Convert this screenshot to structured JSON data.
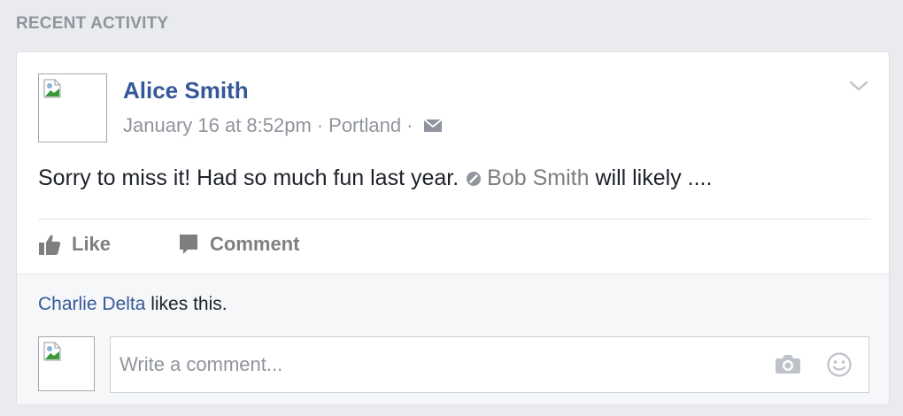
{
  "section": {
    "title": "RECENT ACTIVITY"
  },
  "post": {
    "author": "Alice Smith",
    "timestamp": "January 16 at 8:52pm",
    "separator": "·",
    "location": "Portland",
    "text_before": "Sorry to miss it! Had so much fun last year.",
    "mention": "Bob Smith",
    "text_after": " will likely ....",
    "options_icon": "chevron-down-icon",
    "audience_icon": "envelope-icon",
    "tag_icon": "tag-icon"
  },
  "actions": {
    "like_label": "Like",
    "comment_label": "Comment",
    "like_icon": "thumbs-up-icon",
    "comment_icon": "speech-bubble-icon"
  },
  "likes": {
    "liker": "Charlie Delta",
    "suffix": " likes this."
  },
  "comment_box": {
    "placeholder": "Write a comment...",
    "camera_icon": "camera-icon",
    "emoji_icon": "smiley-icon"
  },
  "colors": {
    "link": "#365899",
    "muted": "#90949c",
    "background": "#e9ebee"
  }
}
